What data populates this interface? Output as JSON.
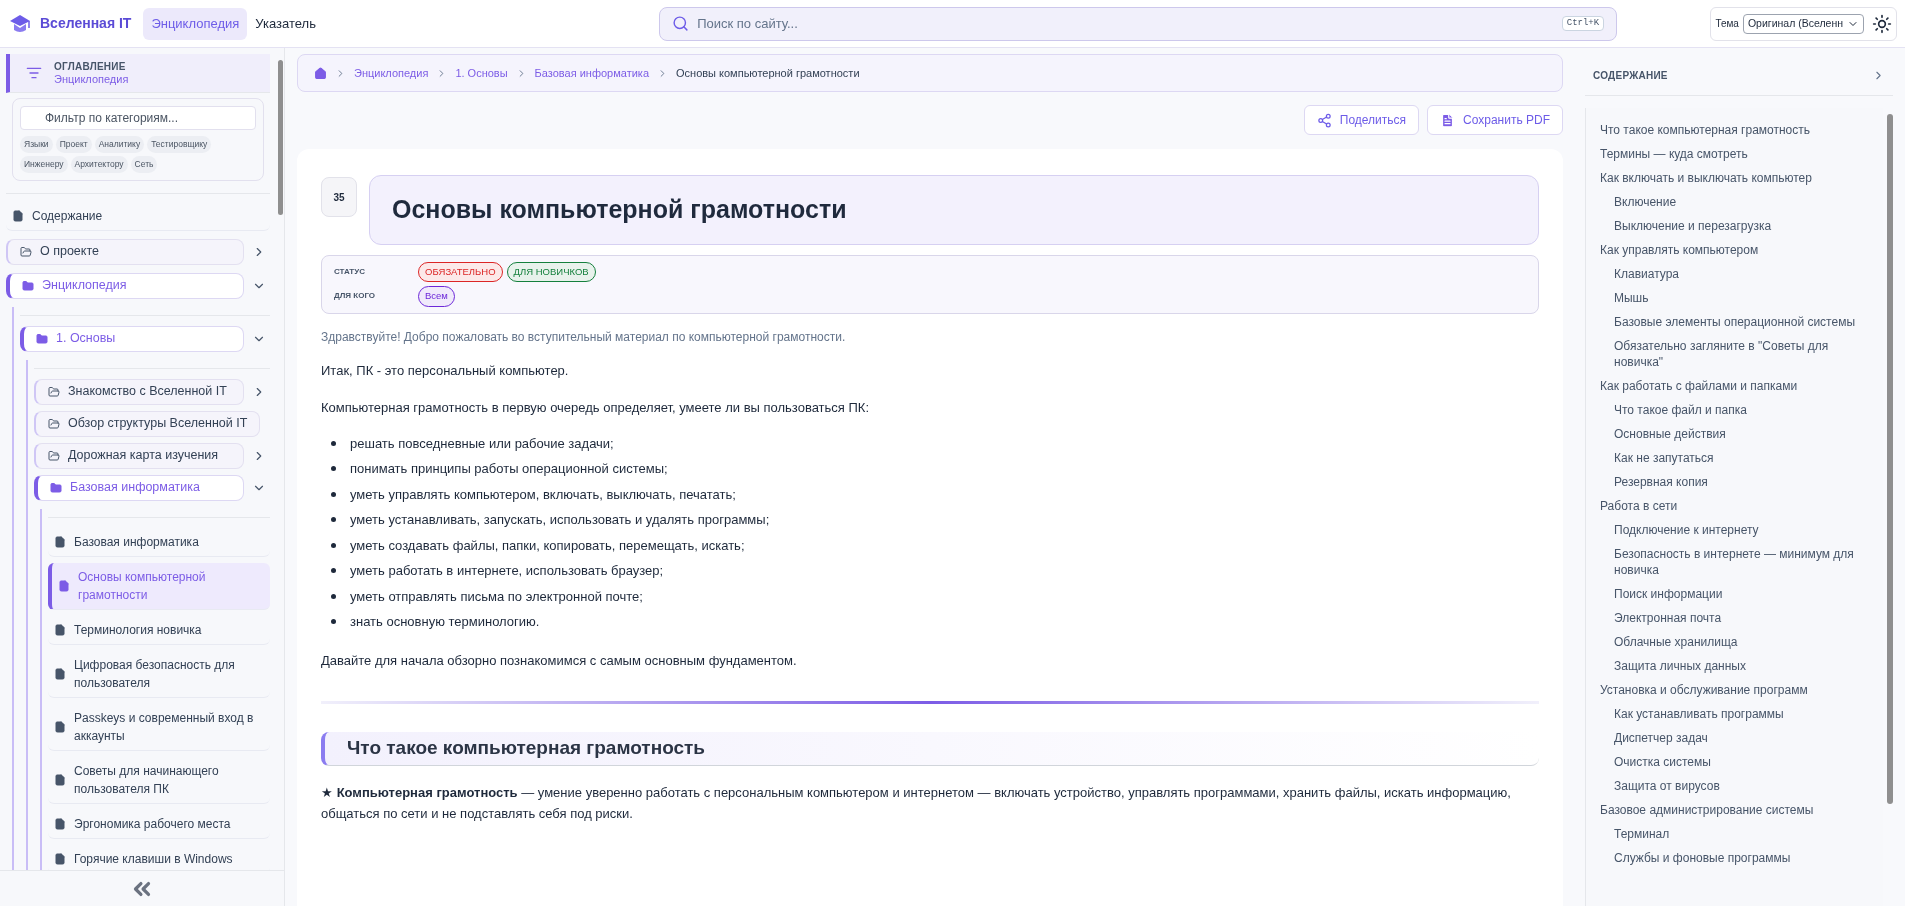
{
  "header": {
    "logo": "Вселенная IT",
    "nav": [
      {
        "label": "Энциклопедия",
        "selected": true
      },
      {
        "label": "Указатель",
        "selected": false
      }
    ],
    "search": {
      "placeholder": "Поиск по сайту...",
      "shortcut": "Ctrl+K"
    },
    "theme": {
      "label": "Тема",
      "value": "Оригинал (Вселенн"
    }
  },
  "sidebar": {
    "title": "ОГЛАВЛЕНИЕ",
    "subtitle": "Энциклопедия",
    "filter": {
      "placeholder": "Фильтр по категориям..."
    },
    "chips": [
      "Языки",
      "Проект",
      "Аналитику",
      "Тестировщику",
      "Инженеру",
      "Архитектору",
      "Сеть"
    ],
    "tree": [
      {
        "label": "Содержание",
        "kind": "page",
        "selected": false
      },
      {
        "label": "О проекте",
        "kind": "folder",
        "expanded": false
      },
      {
        "label": "Энциклопедия",
        "kind": "folder",
        "expanded": true,
        "children": [
          {
            "label": "1. Основы",
            "kind": "folder",
            "expanded": true,
            "children": [
              {
                "label": "Знакомство с Вселенной IT",
                "kind": "folder",
                "expanded": false
              },
              {
                "label": "Обзор структуры Вселенной IT",
                "kind": "folder",
                "expanded": false
              },
              {
                "label": "Дорожная карта изучения",
                "kind": "folder",
                "expanded": false
              },
              {
                "label": "Базовая информатика",
                "kind": "folder",
                "expanded": true,
                "children": [
                  {
                    "label": "Базовая информатика",
                    "kind": "page",
                    "selected": false
                  },
                  {
                    "label": "Основы компьютерной грамотности",
                    "kind": "page",
                    "selected": true
                  },
                  {
                    "label": "Терминология новичка",
                    "kind": "page",
                    "selected": false
                  },
                  {
                    "label": "Цифровая безопасность для пользователя",
                    "kind": "page",
                    "selected": false
                  },
                  {
                    "label": "Passkeys и современный вход в аккаунты",
                    "kind": "page",
                    "selected": false
                  },
                  {
                    "label": "Советы для начинающего пользователя ПК",
                    "kind": "page",
                    "selected": false
                  },
                  {
                    "label": "Эргономика рабочего места",
                    "kind": "page",
                    "selected": false
                  },
                  {
                    "label": "Горячие клавиши в Windows",
                    "kind": "page",
                    "selected": false
                  }
                ]
              }
            ]
          }
        ]
      }
    ]
  },
  "breadcrumb": [
    {
      "label": "Энциклопедия",
      "current": false
    },
    {
      "label": "1. Основы",
      "current": false
    },
    {
      "label": "Базовая информатика",
      "current": false
    },
    {
      "label": "Основы компьютерной грамотности",
      "current": true
    }
  ],
  "actions": [
    {
      "label": "Поделиться",
      "kind": "share"
    },
    {
      "label": "Сохранить PDF",
      "kind": "pdf"
    }
  ],
  "article": {
    "number": "35",
    "title": "Основы компьютерной грамотности",
    "meta": [
      {
        "label": "СТАТУС",
        "tags": [
          {
            "text": "ОБЯЗАТЕЛЬНО",
            "color": "#dc2626"
          },
          {
            "text": "ДЛЯ НОВИЧКОВ",
            "color": "#15803d"
          }
        ]
      },
      {
        "label": "ДЛЯ КОГО",
        "tags": [
          {
            "text": "Всем",
            "color": "#6d28d9"
          }
        ]
      }
    ],
    "blocks": [
      {
        "kind": "lead",
        "text": "Здравствуйте! Добро пожаловать во вступительный материал по компьютерной грамотности."
      },
      {
        "kind": "p",
        "text": "Итак, ПК - это персональный компьютер."
      },
      {
        "kind": "p",
        "text": "Компьютерная грамотность в первую очередь определяет, умеете ли вы пользоваться ПК:"
      },
      {
        "kind": "list",
        "items": [
          "решать повседневные или рабочие задачи;",
          "понимать принципы работы операционной системы;",
          "уметь управлять компьютером, включать, выключать, печатать;",
          "уметь устанавливать, запускать, использовать и удалять программы;",
          "уметь создавать файлы, папки, копировать, перемещать, искать;",
          "уметь работать в интернете, использовать браузер;",
          "уметь отправлять письма по электронной почте;",
          "знать основную терминологию."
        ]
      },
      {
        "kind": "p",
        "text": "Давайте для начала обзорно познакомимся с самым основным фундаментом."
      },
      {
        "kind": "divider"
      },
      {
        "kind": "h2",
        "text": "Что такое компьютерная грамотность"
      },
      {
        "kind": "p",
        "text": "★ **Компьютерная грамотность** — умение уверенно работать с персональным компьютером и интернетом — включать устройство, управлять программами, хранить файлы, искать информацию, общаться по сети и не подставлять себя под риски."
      }
    ]
  },
  "toc": {
    "title": "СОДЕРЖАНИЕ",
    "items": [
      {
        "label": "Что такое компьютерная грамотность"
      },
      {
        "label": "Термины — куда смотреть"
      },
      {
        "label": "Как включать и выключать компьютер",
        "children": [
          {
            "label": "Включение"
          },
          {
            "label": "Выключение и перезагрузка"
          }
        ]
      },
      {
        "label": "Как управлять компьютером",
        "children": [
          {
            "label": "Клавиатура"
          },
          {
            "label": "Мышь"
          },
          {
            "label": "Базовые элементы операционной системы"
          },
          {
            "label": "Обязательно загляните в \"Советы для новичка\""
          }
        ]
      },
      {
        "label": "Как работать с файлами и папками",
        "children": [
          {
            "label": "Что такое файл и папка"
          },
          {
            "label": "Основные действия"
          },
          {
            "label": "Как не запутаться"
          },
          {
            "label": "Резервная копия"
          }
        ]
      },
      {
        "label": "Работа в сети",
        "children": [
          {
            "label": "Подключение к интернету"
          },
          {
            "label": "Безопасность в интернете — минимум для новичка"
          },
          {
            "label": "Поиск информации"
          },
          {
            "label": "Электронная почта"
          },
          {
            "label": "Облачные хранилища"
          },
          {
            "label": "Защита личных данных"
          }
        ]
      },
      {
        "label": "Установка и обслуживание программ",
        "children": [
          {
            "label": "Как устанавливать программы"
          },
          {
            "label": "Диспетчер задач"
          },
          {
            "label": "Очистка системы"
          },
          {
            "label": "Защита от вирусов"
          }
        ]
      },
      {
        "label": "Базовое администрирование системы",
        "children": [
          {
            "label": "Терминал"
          },
          {
            "label": "Службы и фоновые программы"
          }
        ]
      }
    ]
  }
}
